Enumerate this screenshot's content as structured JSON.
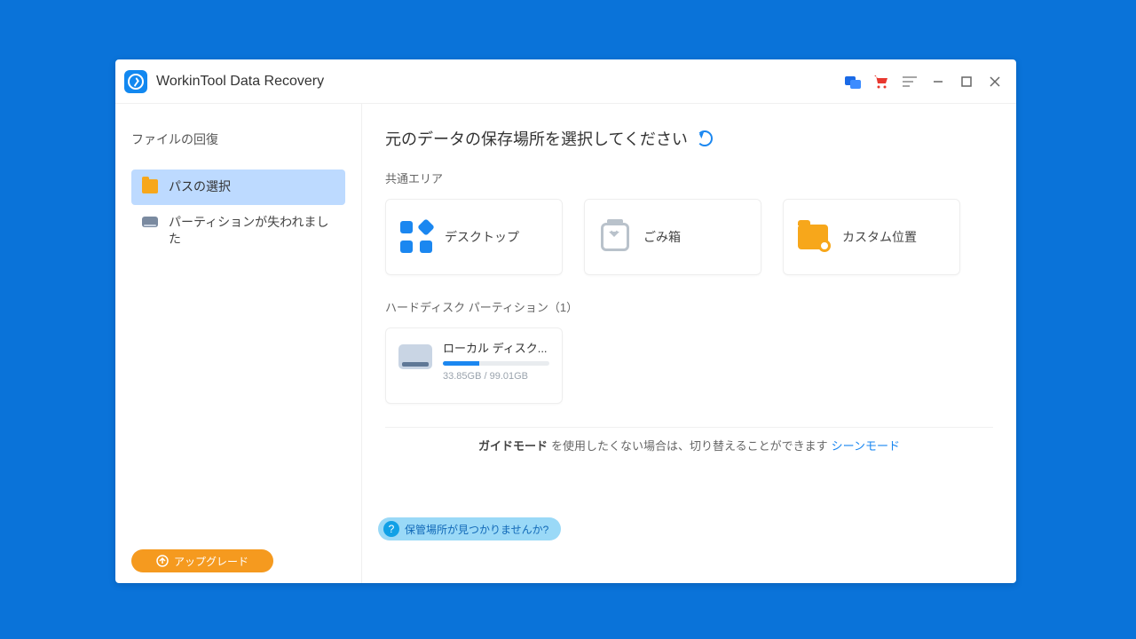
{
  "app": {
    "title": "WorkinTool Data Recovery"
  },
  "sidebar": {
    "heading": "ファイルの回復",
    "items": [
      {
        "label": "パスの選択"
      },
      {
        "label": "パーティションが失われました"
      }
    ],
    "upgrade": "アップグレード"
  },
  "main": {
    "title": "元のデータの保存場所を選択してください",
    "section_common": "共通エリア",
    "cards": {
      "desktop": "デスクトップ",
      "recycle": "ごみ箱",
      "custom": "カスタム位置"
    },
    "section_partitions": "ハードディスク パーティション（1）",
    "disk": {
      "name": "ローカル ディスク...",
      "size": "33.85GB / 99.01GB",
      "percent": 34
    },
    "help": "保管場所が見つかりませんか?"
  },
  "footer": {
    "bold": "ガイドモード",
    "text": " を使用したくない場合は、切り替えることができます ",
    "link": "シーンモード"
  }
}
